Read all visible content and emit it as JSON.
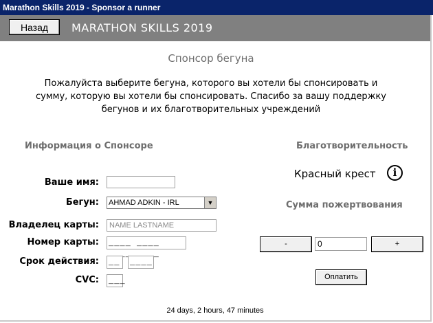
{
  "window": {
    "title": "Marathon Skills 2019 - Sponsor a runner"
  },
  "header": {
    "back_label": "Назад",
    "app_title": "MARATHON SKILLS 2019"
  },
  "page": {
    "title": "Спонсор бегуна",
    "intro": "Пожалуйста выберите бегуна, которого вы хотели бы спонсировать и сумму, которую вы хотели бы спонсировать. Спасибо за вашу поддержку бегунов и их благотворительных учреждений"
  },
  "sponsor_info": {
    "section_title": "Информация о Спонсоре",
    "name_label": "Ваше имя:",
    "name_value": "",
    "runner_label": "Бегун:",
    "runner_selected": "AHMAD ADKIN - IRL",
    "cardholder_label": "Владелец карты:",
    "cardholder_placeholder": "NAME LASTNAME",
    "card_number_label": "Номер карты:",
    "card_number_mask": "____ ____ ____ ____",
    "expiry_label": "Срок действия:",
    "expiry_month_mask": "__",
    "expiry_year_mask": "____",
    "cvc_label": "CVC:",
    "cvc_mask": "___"
  },
  "charity": {
    "section_title": "Благотворительность",
    "name": "Красный крест",
    "info_icon": "info-icon",
    "donation_title": "Сумма пожертвования",
    "decrement_label": "-",
    "amount_value": "0",
    "increment_label": "+",
    "pay_label": "Оплатить"
  },
  "footer": {
    "countdown": "24 days, 2 hours, 47 minutes"
  }
}
